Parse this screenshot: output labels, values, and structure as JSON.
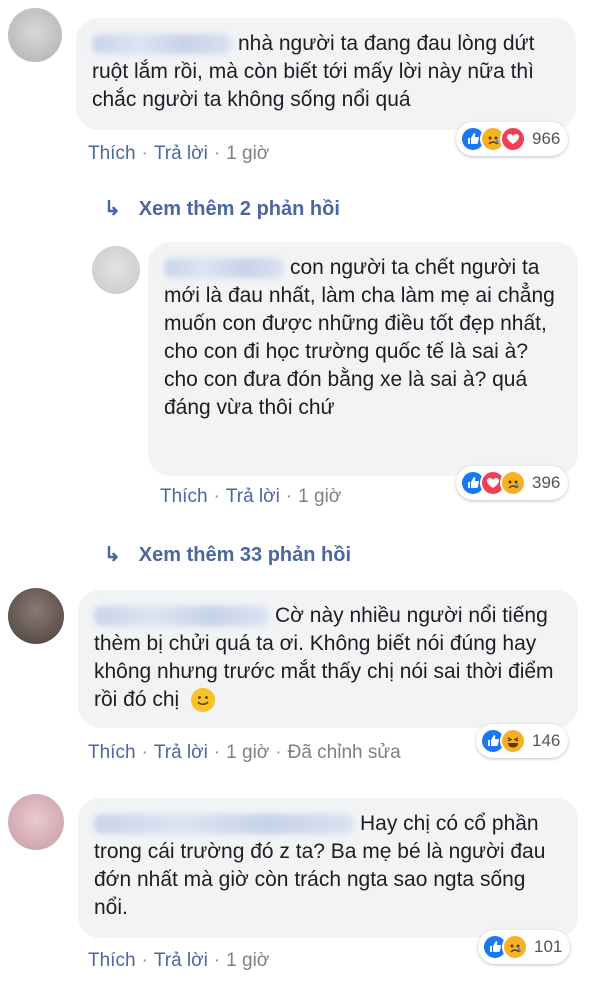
{
  "comments": [
    {
      "text": "nhà người ta đang đau lòng dứt ruột lắm rồi, mà còn biết tới mấy lời này nữa thì chắc người ta không sống nổi quá",
      "like_label": "Thích",
      "reply_label": "Trả lời",
      "time": "1 giờ",
      "reaction_count": "966",
      "reactions": [
        "like",
        "sad",
        "love"
      ]
    },
    {
      "text": "con người ta chết người ta mới là đau nhất, làm cha làm mẹ ai chẳng muốn con được những điều tốt đẹp nhất, cho con đi học trường quốc tế là sai à? cho con đưa đón bằng xe là sai à? quá đáng vừa thôi chứ",
      "like_label": "Thích",
      "reply_label": "Trả lời",
      "time": "1 giờ",
      "reaction_count": "396",
      "reactions": [
        "like",
        "love",
        "sad"
      ]
    },
    {
      "text": "Cờ này nhiều người nổi tiếng thèm bị chửi quá ta ơi. Không biết nói đúng hay không nhưng trước mắt thấy chị nói sai thời điểm rồi đó chị",
      "like_label": "Thích",
      "reply_label": "Trả lời",
      "time": "1 giờ",
      "edited": "Đã chỉnh sửa",
      "reaction_count": "146",
      "reactions": [
        "like",
        "haha"
      ]
    },
    {
      "text": "Hay chị có cổ phần trong cái trường đó z ta? Ba mẹ bé là người đau đớn nhất mà giờ còn trách ngta sao ngta sống nổi.",
      "like_label": "Thích",
      "reply_label": "Trả lời",
      "time": "1 giờ",
      "reaction_count": "101",
      "reactions": [
        "like",
        "sad"
      ]
    }
  ],
  "view_more": [
    "Xem thêm 2 phản hồi",
    "Xem thêm 33 phản hồi"
  ],
  "icons": {
    "like": "like-icon",
    "love": "love-icon",
    "sad": "sad-icon",
    "haha": "haha-icon",
    "smile": "smile-emoji-icon",
    "reply_arrow": "reply-arrow-icon"
  },
  "colors": {
    "link": "#4b67a1",
    "bubble": "#f2f3f5",
    "like_blue": "#1877f2",
    "love_red": "#f33e58",
    "emoji_yellow": "#f7b125"
  }
}
